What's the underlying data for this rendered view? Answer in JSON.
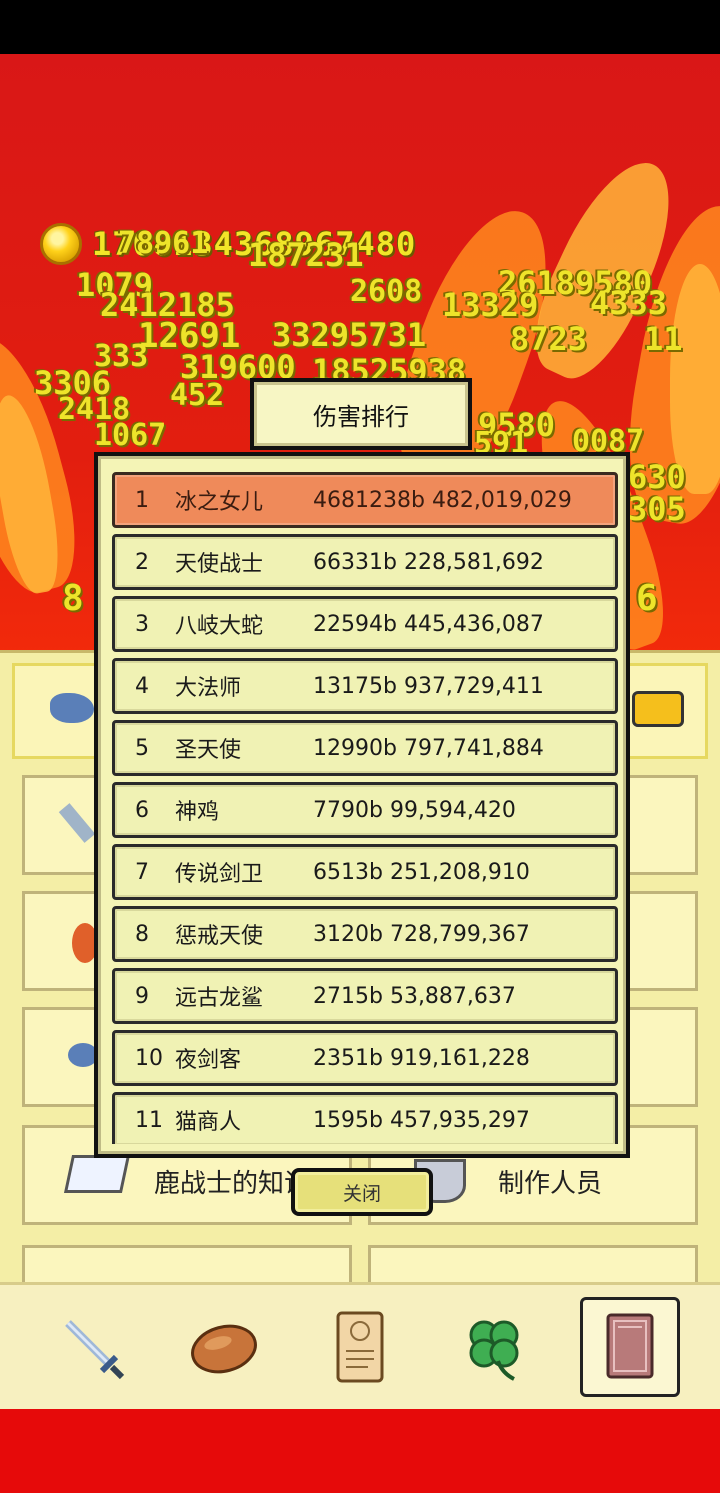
{
  "gold": "1708134368967480",
  "floating_numbers": [
    "78961",
    "187231",
    "1079",
    "26189580",
    "2412185",
    "2608",
    "13329",
    "4333",
    "12691",
    "33295731",
    "8723",
    "11",
    "333",
    "319600",
    "18525938",
    "3306",
    "452",
    "2418",
    "9580",
    "1067",
    "591",
    "0087",
    "630",
    "305",
    "8",
    "6"
  ],
  "dialog": {
    "title": "伤害排行",
    "close_label": "关闭",
    "rows": [
      {
        "rank": "1",
        "name": "冰之女儿",
        "value": "4681238b 482,019,029"
      },
      {
        "rank": "2",
        "name": "天使战士",
        "value": "66331b 228,581,692"
      },
      {
        "rank": "3",
        "name": "八岐大蛇",
        "value": "22594b 445,436,087"
      },
      {
        "rank": "4",
        "name": "大法师",
        "value": "13175b 937,729,411"
      },
      {
        "rank": "5",
        "name": "圣天使",
        "value": "12990b 797,741,884"
      },
      {
        "rank": "6",
        "name": "神鸡",
        "value": "7790b 99,594,420"
      },
      {
        "rank": "7",
        "name": "传说剑卫",
        "value": "6513b 251,208,910"
      },
      {
        "rank": "8",
        "name": "惩戒天使",
        "value": "3120b 728,799,367"
      },
      {
        "rank": "9",
        "name": "远古龙鲨",
        "value": "2715b 53,887,637"
      },
      {
        "rank": "10",
        "name": "夜剑客",
        "value": "2351b 919,161,228"
      },
      {
        "rank": "11",
        "name": "猫商人",
        "value": "1595b 457,935,297"
      }
    ]
  },
  "menu": {
    "knowledge_label": "鹿战士的知识",
    "credits_label": "制作人员"
  },
  "tabs": [
    "sword-icon",
    "bread-icon",
    "scroll-icon",
    "clover-icon",
    "book-icon"
  ],
  "colors": {
    "background_red": "#e21e0f",
    "number_yellow": "#eee42a",
    "top_row": "#ef8a5a",
    "row": "#f0f2b4"
  }
}
